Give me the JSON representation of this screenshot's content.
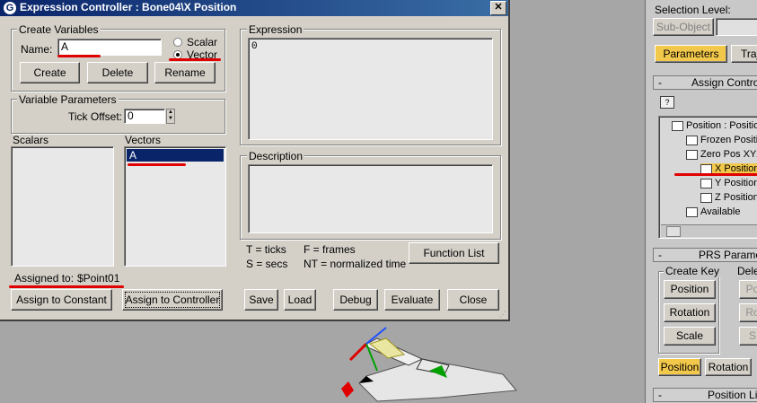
{
  "dialog": {
    "title": "Expression Controller : Bone04\\X Position",
    "close_glyph": "✕",
    "create_variables": {
      "legend": "Create Variables",
      "name_label": "Name:",
      "name_value": "A",
      "scalar_label": "Scalar",
      "vector_label": "Vector",
      "selected_type": "Vector",
      "create_label": "Create",
      "delete_label": "Delete",
      "rename_label": "Rename"
    },
    "variable_parameters": {
      "legend": "Variable Parameters",
      "tick_offset_label": "Tick Offset:",
      "tick_offset_value": "0"
    },
    "scalars_label": "Scalars",
    "vectors_label": "Vectors",
    "vectors_items": [
      "A"
    ],
    "assigned_to_label": "Assigned to:",
    "assigned_to_value": "$Point01",
    "assign_to_constant_label": "Assign to Constant",
    "assign_to_controller_label": "Assign to Controller",
    "expression_legend": "Expression",
    "expression_text": "0",
    "description_legend": "Description",
    "description_text": "",
    "legend_t": "T = ticks",
    "legend_f": "F = frames",
    "legend_s": "S = secs",
    "legend_nt": "NT = normalized time",
    "function_list_label": "Function List",
    "save_label": "Save",
    "load_label": "Load",
    "debug_label": "Debug",
    "evaluate_label": "Evaluate",
    "close_label": "Close"
  },
  "right_panel": {
    "selection_level_label": "Selection Level:",
    "subobject_label": "Sub-Object",
    "tab_parameters": "Parameters",
    "tab_trajectories": "Traj",
    "assign_controller_header": "Assign Controlle",
    "tree_items": [
      "Position : Position",
      "Frozen Position",
      "Zero Pos XYZ",
      "X Position",
      "Y Position",
      "Z Position",
      "Available"
    ],
    "prs_header": "PRS Paramete",
    "create_key_label": "Create Key",
    "delete_key_label": "Dele",
    "position_btn": "Position",
    "rotation_btn": "Rotation",
    "scale_btn": "Scale",
    "right_pos_btn": "Po",
    "right_rot_btn": "Ro",
    "right_scale_btn": "S",
    "bottom_position": "Position",
    "bottom_rotation": "Rotation",
    "position_list_header": "Position List",
    "collapse_glyph": "-"
  },
  "colors": {
    "title_bar": "#0a246a",
    "annotation": "#e00000",
    "selected_tab": "#f2c84b"
  }
}
